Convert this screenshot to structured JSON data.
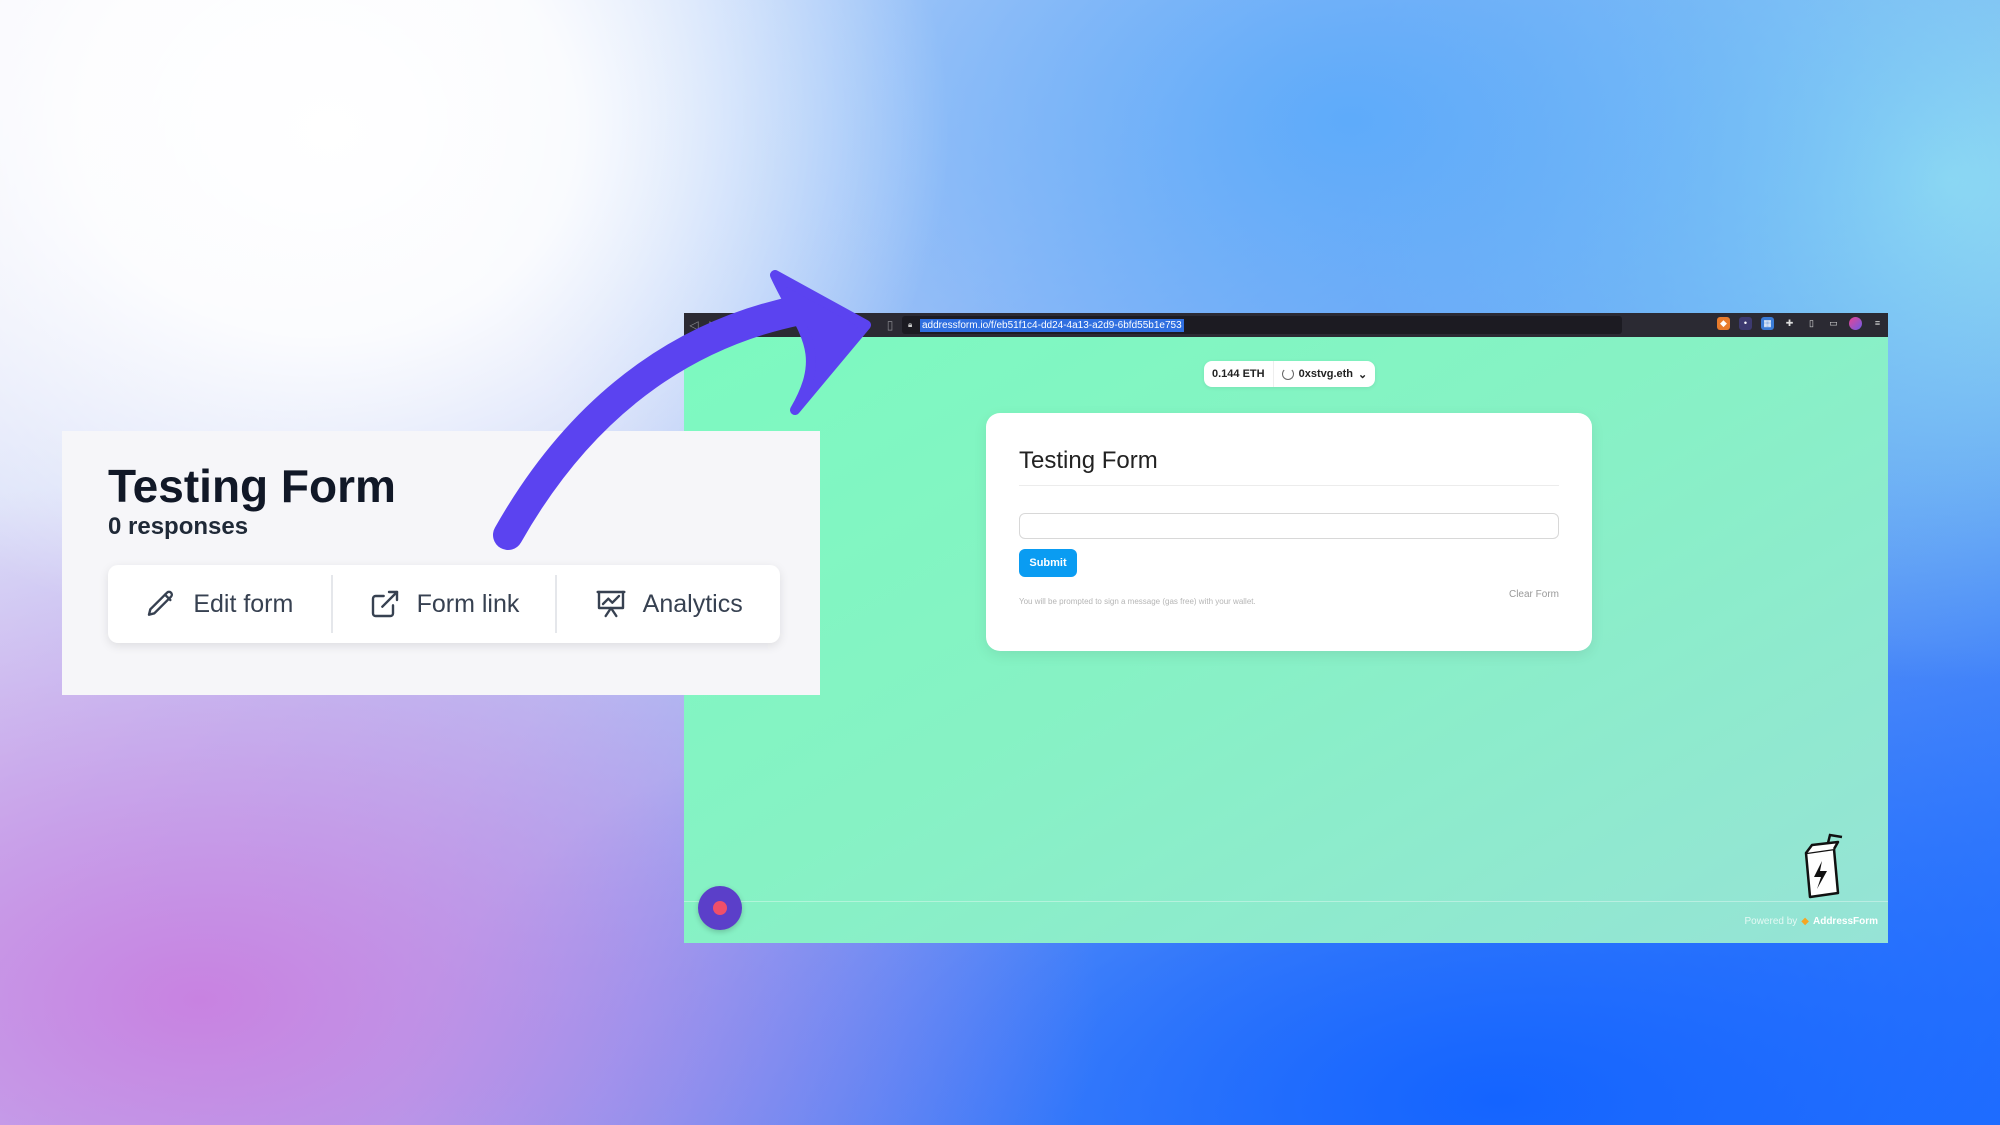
{
  "overlay": {
    "title": "Testing Form",
    "responses": "0 responses",
    "actions": [
      {
        "label": "Edit form",
        "icon": "pencil-icon"
      },
      {
        "label": "Form link",
        "icon": "external-link-icon"
      },
      {
        "label": "Analytics",
        "icon": "presentation-chart-icon"
      }
    ]
  },
  "browser": {
    "url": "addressform.io/f/eb51f1c4-dd24-4a13-a2d9-6bfd55b1e753"
  },
  "wallet": {
    "balance": "0.144 ETH",
    "account": "0xstvg.eth"
  },
  "form": {
    "title": "Testing Form",
    "submit_label": "Submit",
    "note": "You will be prompted to sign a message (gas free) with your wallet.",
    "clear_label": "Clear Form"
  },
  "footer": {
    "powered_by": "Powered by",
    "brand": "AddressForm"
  },
  "colors": {
    "arrow": "#5b43f0",
    "submit": "#0a9cf2",
    "record_button": "#5b3fc9"
  }
}
